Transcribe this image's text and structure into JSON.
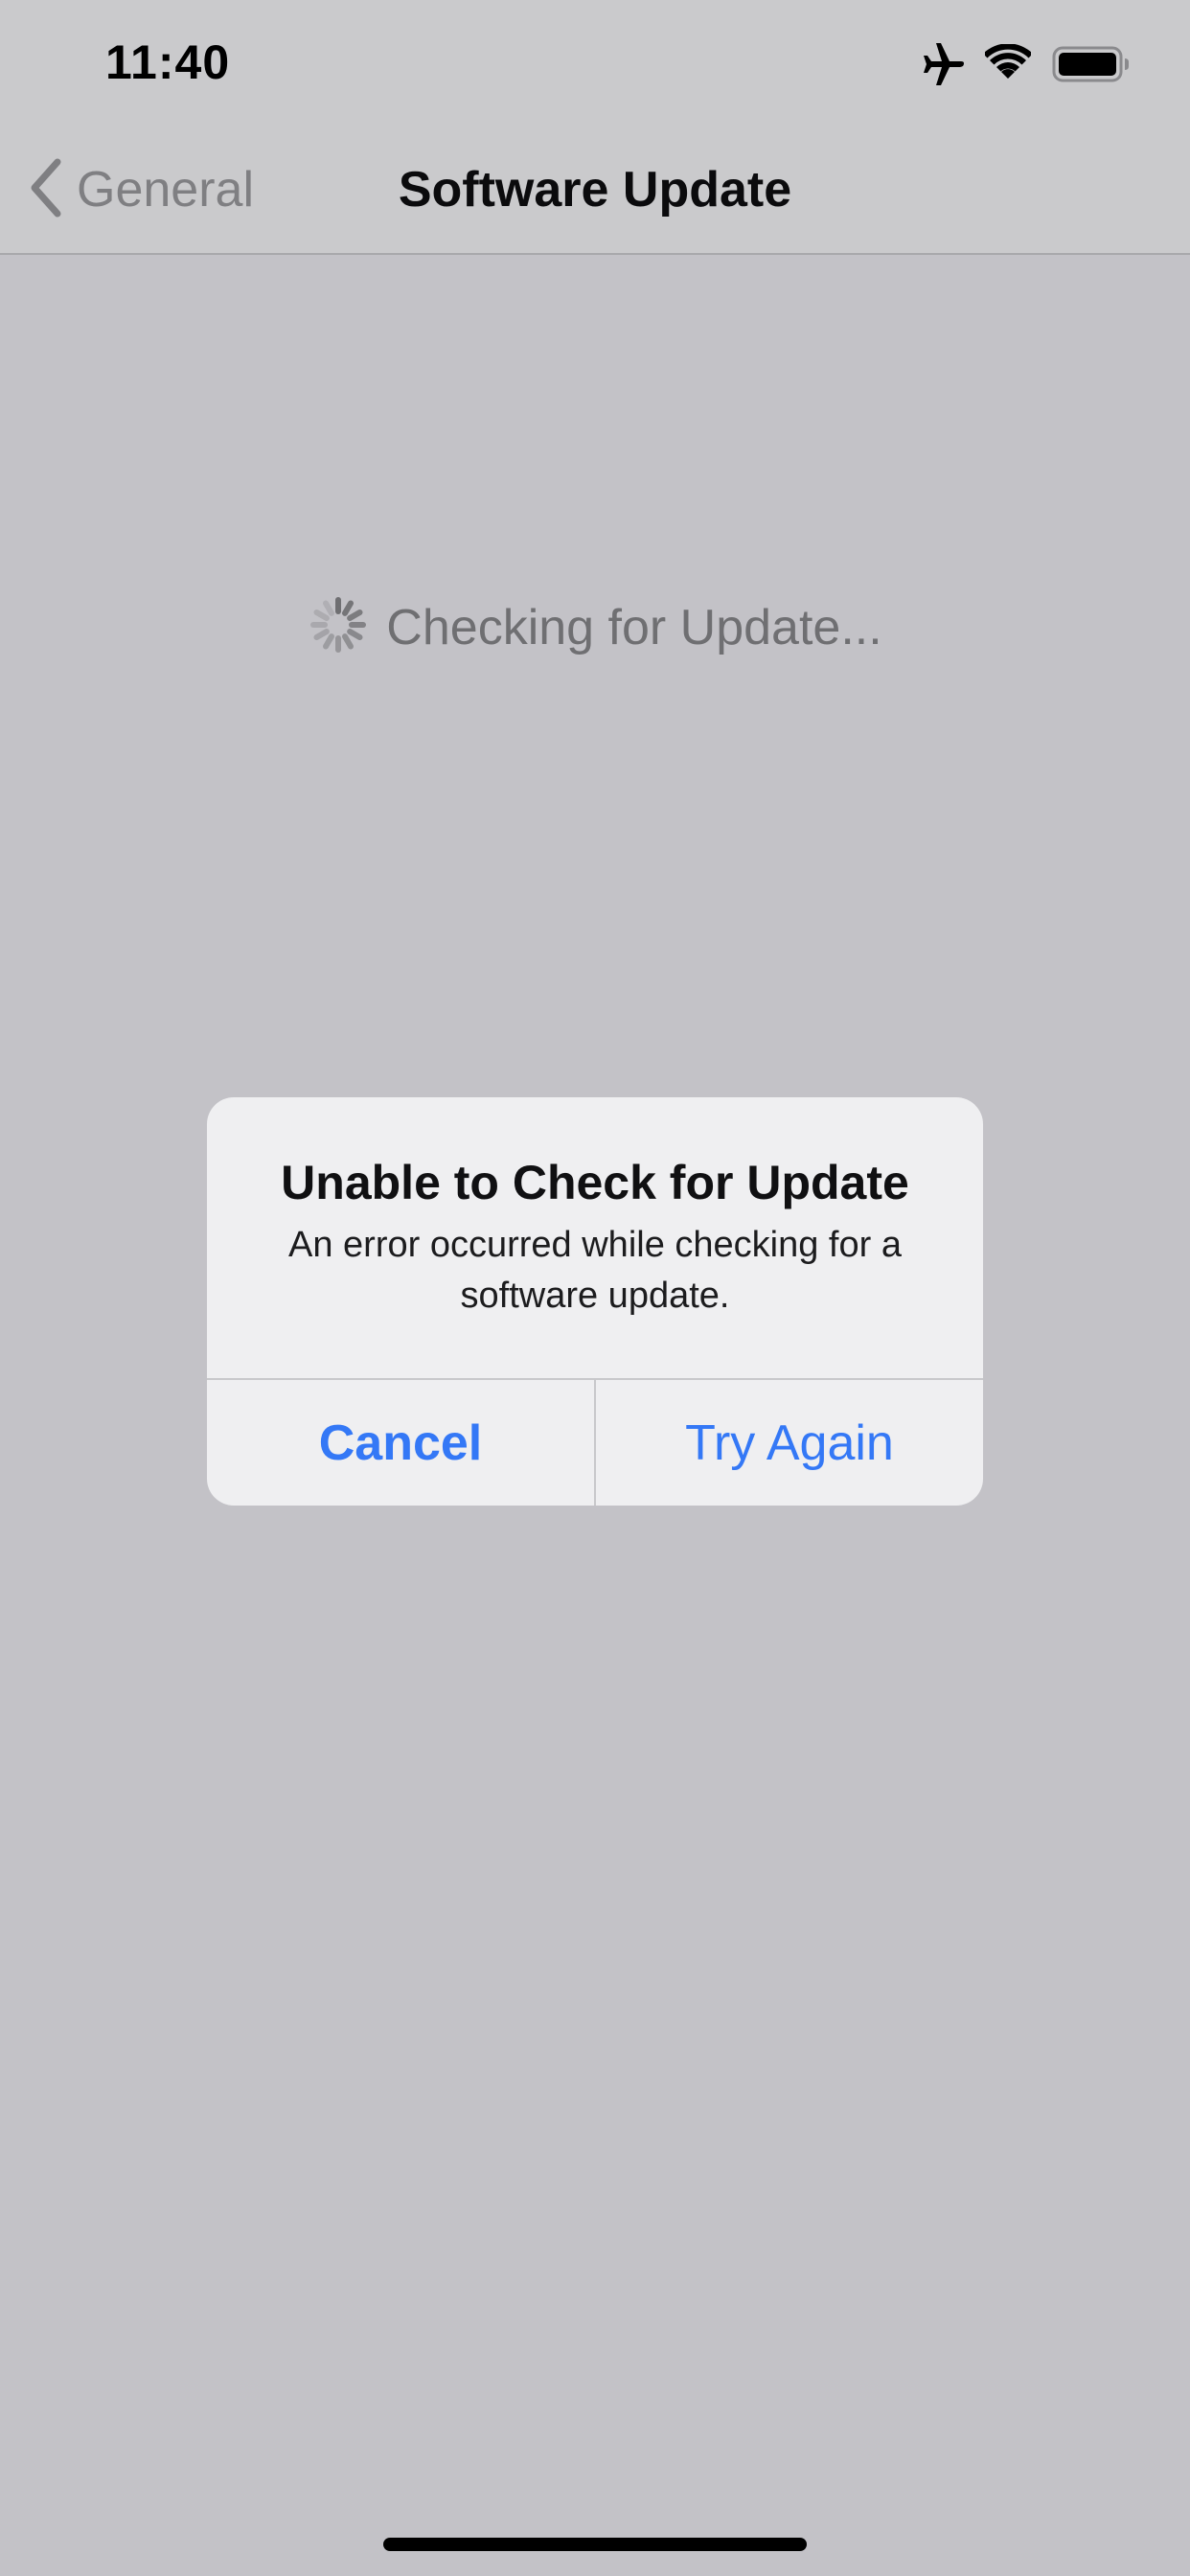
{
  "status_bar": {
    "time": "11:40",
    "icons": [
      "airplane-icon",
      "wifi-icon",
      "battery-icon"
    ]
  },
  "nav": {
    "back_label": "General",
    "title": "Software Update"
  },
  "main": {
    "status_text": "Checking for Update..."
  },
  "alert": {
    "title": "Unable to Check for Update",
    "message": "An error occurred while checking for a software update.",
    "cancel_label": "Cancel",
    "try_again_label": "Try Again"
  },
  "colors": {
    "accent": "#3478f6",
    "background": "#c3c2c7",
    "alert_background": "#efeff1"
  }
}
